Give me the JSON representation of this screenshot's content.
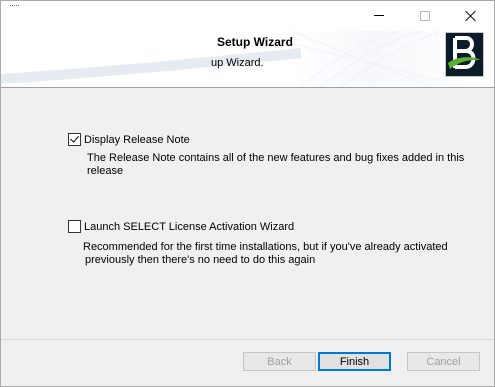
{
  "window": {
    "title_glyph": "..."
  },
  "banner": {
    "title": "Setup Wizard",
    "subtitle": "up Wizard.",
    "logo": "bentley-b-logo"
  },
  "options": {
    "release_note": {
      "label": "Display Release Note",
      "checked": true,
      "description": "The Release Note contains all of the new features and bug fixes added in this release"
    },
    "license_wizard": {
      "label": "Launch SELECT License Activation Wizard",
      "checked": false,
      "description_line1": "Recommended for the first time installations, but if you've already activated",
      "description_line2": "previously then there's no need to do this again"
    }
  },
  "buttons": {
    "back": "Back",
    "finish": "Finish",
    "cancel": "Cancel"
  },
  "icons": {
    "minimize": "minimize-icon",
    "maximize": "maximize-icon",
    "close": "close-icon"
  },
  "colors": {
    "accent": "#0078d7",
    "logo_bg": "#0b1b2a",
    "logo_green": "#5ab030",
    "window_bg": "#f0f0f0"
  }
}
